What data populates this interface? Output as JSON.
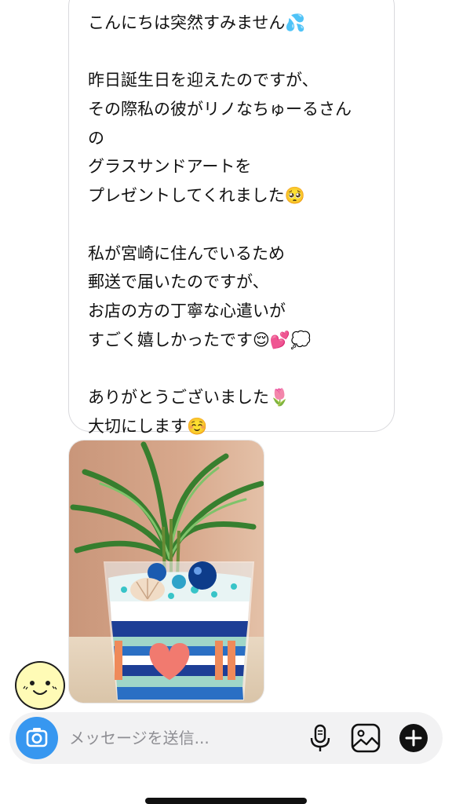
{
  "chat": {
    "message_lines": [
      "こんにちは突然すみません💦",
      "",
      "昨日誕生日を迎えたのですが、",
      "その際私の彼がリノなちゅーるさん",
      "の",
      "グラスサンドアートを",
      "プレゼントしてくれました🥺",
      "",
      "私が宮崎に住んでいるため",
      "郵送で届いたのですが、",
      "お店の方の丁寧な心遣いが",
      "すごく嬉しかったです😌💕💭",
      "",
      "ありがとうございました🌷",
      "大切にします☺️"
    ]
  },
  "composer": {
    "placeholder": "メッセージを送信...",
    "camera_icon": "camera-icon",
    "mic_icon": "microphone-icon",
    "gallery_icon": "image-icon",
    "add_icon": "plus-icon"
  },
  "colors": {
    "accent": "#3797f0",
    "bubble_border": "#d9d9dd",
    "composer_bg": "#f2f2f3"
  }
}
